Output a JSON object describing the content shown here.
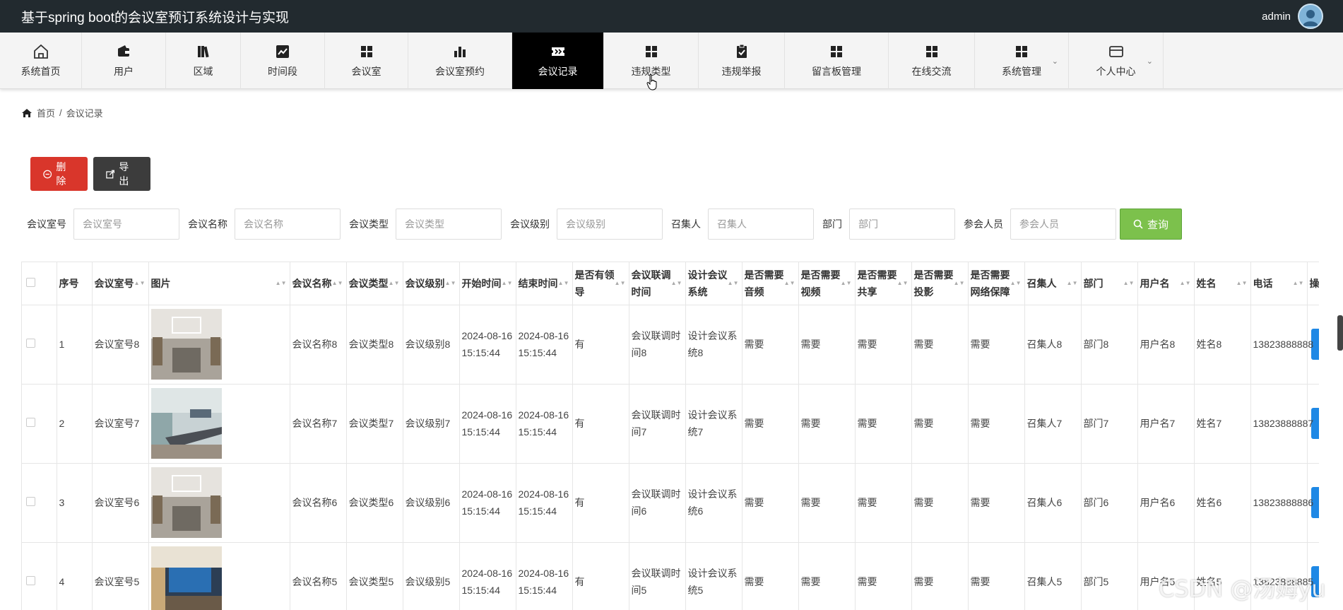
{
  "app": {
    "title": "基于spring boot的会议室预订系统设计与实现",
    "username": "admin"
  },
  "nav": {
    "items": [
      {
        "label": "系统首页",
        "icon": "home-icon"
      },
      {
        "label": "用户",
        "icon": "wallet-icon"
      },
      {
        "label": "区域",
        "icon": "books-icon"
      },
      {
        "label": "时间段",
        "icon": "chart-line-icon"
      },
      {
        "label": "会议室",
        "icon": "grid-icon"
      },
      {
        "label": "会议室预约",
        "icon": "bar-chart-icon"
      },
      {
        "label": "会议记录",
        "icon": "ticket-icon"
      },
      {
        "label": "违规类型",
        "icon": "grid-icon"
      },
      {
        "label": "违规举报",
        "icon": "clipboard-check-icon"
      },
      {
        "label": "留言板管理",
        "icon": "grid-icon"
      },
      {
        "label": "在线交流",
        "icon": "grid-icon"
      },
      {
        "label": "系统管理",
        "icon": "grid-icon"
      },
      {
        "label": "个人中心",
        "icon": "card-icon"
      }
    ],
    "active_label": "会议记录"
  },
  "breadcrumb": {
    "home": "首页",
    "separator": "/",
    "current": "会议记录"
  },
  "actions": {
    "delete_label": "删除",
    "export_label": "导出",
    "search_label": "查询"
  },
  "search": {
    "fields": [
      {
        "label": "会议室号",
        "placeholder": "会议室号"
      },
      {
        "label": "会议名称",
        "placeholder": "会议名称"
      },
      {
        "label": "会议类型",
        "placeholder": "会议类型"
      },
      {
        "label": "会议级别",
        "placeholder": "会议级别"
      },
      {
        "label": "召集人",
        "placeholder": "召集人"
      },
      {
        "label": "部门",
        "placeholder": "部门"
      },
      {
        "label": "参会人员",
        "placeholder": "参会人员"
      }
    ]
  },
  "table": {
    "headers": [
      "序号",
      "会议室号",
      "图片",
      "会议名称",
      "会议类型",
      "会议级别",
      "开始时间",
      "结束时间",
      "是否有领导",
      "会议联调时间",
      "设计会议系统",
      "是否需要音频",
      "是否需要视频",
      "是否需要共享",
      "是否需要投影",
      "是否需要网络保障",
      "召集人",
      "部门",
      "用户名",
      "姓名",
      "电话",
      "操作"
    ],
    "rows": [
      {
        "no": "1",
        "room": "会议室号8",
        "name": "会议名称8",
        "type": "会议类型8",
        "level": "会议级别8",
        "start": "2024-08-16 15:15:44",
        "end": "2024-08-16 15:15:44",
        "leader": "有",
        "debug_time": "会议联调时间8",
        "design": "设计会议系统8",
        "audio": "需要",
        "video": "需要",
        "share": "需要",
        "projector": "需要",
        "network": "需要",
        "convener": "召集人8",
        "dept": "部门8",
        "username": "用户名8",
        "realname": "姓名8",
        "phone": "13823888888"
      },
      {
        "no": "2",
        "room": "会议室号7",
        "name": "会议名称7",
        "type": "会议类型7",
        "level": "会议级别7",
        "start": "2024-08-16 15:15:44",
        "end": "2024-08-16 15:15:44",
        "leader": "有",
        "debug_time": "会议联调时间7",
        "design": "设计会议系统7",
        "audio": "需要",
        "video": "需要",
        "share": "需要",
        "projector": "需要",
        "network": "需要",
        "convener": "召集人7",
        "dept": "部门7",
        "username": "用户名7",
        "realname": "姓名7",
        "phone": "13823888887"
      },
      {
        "no": "3",
        "room": "会议室号6",
        "name": "会议名称6",
        "type": "会议类型6",
        "level": "会议级别6",
        "start": "2024-08-16 15:15:44",
        "end": "2024-08-16 15:15:44",
        "leader": "有",
        "debug_time": "会议联调时间6",
        "design": "设计会议系统6",
        "audio": "需要",
        "video": "需要",
        "share": "需要",
        "projector": "需要",
        "network": "需要",
        "convener": "召集人6",
        "dept": "部门6",
        "username": "用户名6",
        "realname": "姓名6",
        "phone": "13823888886"
      },
      {
        "no": "4",
        "room": "会议室号5",
        "name": "会议名称5",
        "type": "会议类型5",
        "level": "会议级别5",
        "start": "2024-08-16 15:15:44",
        "end": "2024-08-16 15:15:44",
        "leader": "有",
        "debug_time": "会议联调时间5",
        "design": "设计会议系统5",
        "audio": "需要",
        "video": "需要",
        "share": "需要",
        "projector": "需要",
        "network": "需要",
        "convener": "召集人5",
        "dept": "部门5",
        "username": "用户名5",
        "realname": "姓名5",
        "phone": "13823888885"
      }
    ]
  },
  "watermark": "CSDN @汤姆yu",
  "colors": {
    "topbar": "#222a2f",
    "delete": "#d9362b",
    "export": "#3c3c3c",
    "search": "#7cc14c",
    "op": "#1e88e5"
  }
}
